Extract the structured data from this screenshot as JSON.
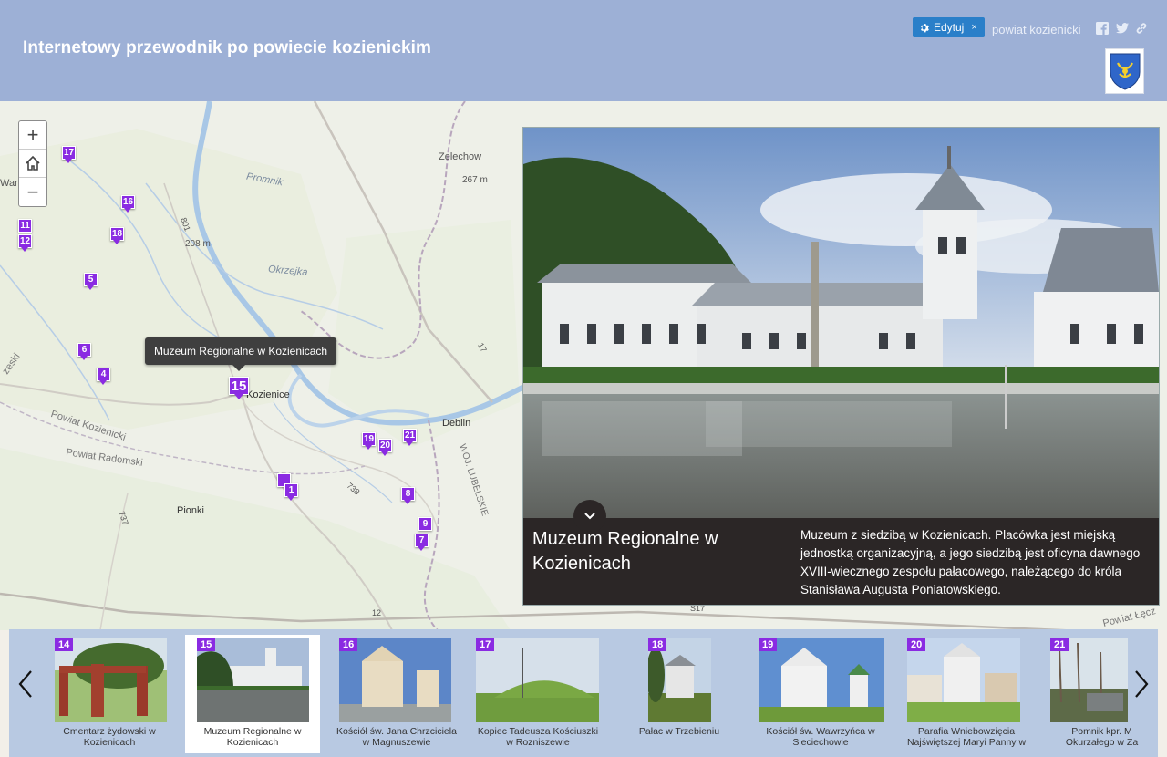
{
  "header": {
    "title": "Internetowy przewodnik po powiecie kozienickim",
    "edit_label": "Edytuj",
    "edit_close": "×",
    "link_text": "powiat kozienicki"
  },
  "map": {
    "labels": {
      "zelechow": "Zelechow",
      "alt267": "267 m",
      "promnik": "Promnik",
      "alt208": "208 m",
      "okrzejka": "Okrzejka",
      "kozienice": "Kozienice",
      "deblin": "Deblin",
      "powiat_kozienicki": "Powiat Kozienicki",
      "powiat_radomski": "Powiat Radomski",
      "pionki": "Pionki",
      "woj_lubelskie": "WOJ. LUBELSKIE",
      "powiat_lecz": "Powiat Łęcz",
      "road17": "17",
      "road12": "12",
      "road801": "801",
      "road737": "737",
      "road738": "738",
      "roadS17": "S17",
      "warka": "Wark",
      "zeski": "zeski"
    },
    "tooltip": "Muzeum Regionalne w Kozienicach",
    "markers": [
      "17",
      "16",
      "11",
      "12",
      "18",
      "5",
      "6",
      "4",
      "15",
      "19",
      "20",
      "21",
      "1",
      "8",
      "9",
      "7"
    ]
  },
  "panel": {
    "title": "Muzeum Regionalne w Kozienicach",
    "description": "Muzeum z siedzibą w Kozienicach. Placówka jest miejską jednostką organizacyjną, a jego siedzibą jest oficyna dawnego XVIII-wiecznego zespołu pałacowego, należącego do króla Stanisława Augusta Poniatowskiego."
  },
  "carousel": {
    "items": [
      {
        "num": "14",
        "label": "Cmentarz żydowski w Kozienicach"
      },
      {
        "num": "15",
        "label": "Muzeum Regionalne w Kozienicach"
      },
      {
        "num": "16",
        "label": "Kościół św. Jana Chrzciciela w Magnuszewie"
      },
      {
        "num": "17",
        "label": "Kopiec Tadeusza Kościuszki w Rozniszewie"
      },
      {
        "num": "18",
        "label": "Pałac w Trzebieniu"
      },
      {
        "num": "19",
        "label": "Kościół św. Wawrzyńca w Sieciechowie"
      },
      {
        "num": "20",
        "label": "Parafia Wniebowzięcia Najświętszej Maryi Panny w"
      },
      {
        "num": "21",
        "label": "Pomnik kpr. M Okurzałego w Za"
      }
    ]
  },
  "colors": {
    "header_bg": "#9db0d6",
    "marker": "#8a2be2",
    "edit_button": "#2a7fc9",
    "caption_bg": "#2b2626",
    "carousel_bg": "#b8c9e2"
  }
}
